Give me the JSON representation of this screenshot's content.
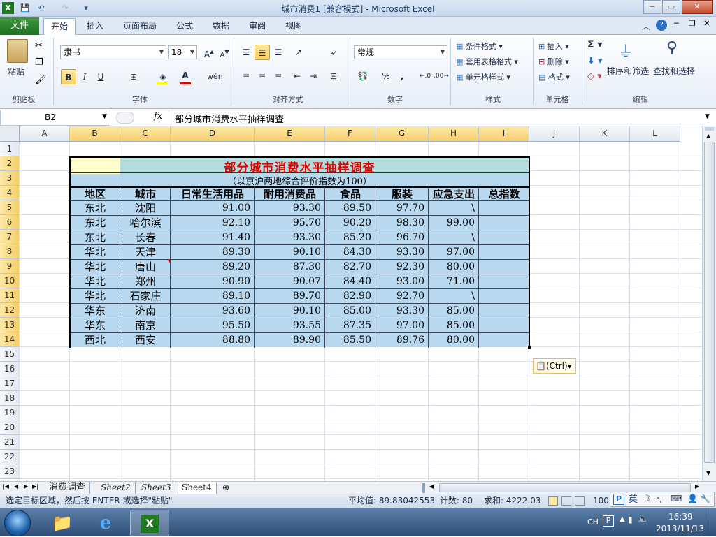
{
  "window": {
    "title": "城市消费1  [兼容模式]  -  Microsoft Excel",
    "min": "─",
    "max": "▭",
    "close": "✕"
  },
  "tabs": {
    "file": "文件",
    "items": [
      "开始",
      "插入",
      "页面布局",
      "公式",
      "数据",
      "审阅",
      "视图"
    ]
  },
  "ribbon": {
    "clipboard": {
      "label": "剪贴板",
      "paste": "粘贴"
    },
    "font": {
      "label": "字体",
      "name": "隶书",
      "size": "18",
      "bold": "B",
      "italic": "I",
      "underline": "U"
    },
    "align": {
      "label": "对齐方式"
    },
    "number": {
      "label": "数字",
      "format": "常规",
      "percent": "%",
      "comma": ","
    },
    "styles": {
      "label": "样式",
      "cond": "条件格式",
      "table": "套用表格格式",
      "cell": "单元格样式"
    },
    "cells": {
      "label": "单元格",
      "insert": "插入",
      "delete": "删除",
      "format": "格式"
    },
    "edit": {
      "label": "编辑",
      "sort": "排序和筛选",
      "find": "查找和选择",
      "sum": "Σ"
    }
  },
  "formula_bar": {
    "namebox": "B2",
    "fx": "fx",
    "content": "部分城市消费水平抽样调查"
  },
  "columns": [
    "A",
    "B",
    "C",
    "D",
    "E",
    "F",
    "G",
    "H",
    "I",
    "J",
    "K",
    "L"
  ],
  "rows": [
    "1",
    "2",
    "3",
    "4",
    "5",
    "6",
    "7",
    "8",
    "9",
    "10",
    "11",
    "12",
    "13",
    "14",
    "15",
    "16",
    "17",
    "18",
    "19",
    "20",
    "21",
    "22",
    "23"
  ],
  "sheet": {
    "title": "部分城市消费水平抽样调查",
    "subtitle": "（以京沪两地综合评价指数为100）",
    "headers": [
      "地区",
      "城市",
      "日常生活用品",
      "耐用消费品",
      "食品",
      "服装",
      "应急支出",
      "总指数"
    ],
    "data": [
      [
        "东北",
        "沈阳",
        "91.00",
        "93.30",
        "89.50",
        "97.70",
        "\\",
        ""
      ],
      [
        "东北",
        "哈尔滨",
        "92.10",
        "95.70",
        "90.20",
        "98.30",
        "99.00",
        ""
      ],
      [
        "东北",
        "长春",
        "91.40",
        "93.30",
        "85.20",
        "96.70",
        "\\",
        ""
      ],
      [
        "华北",
        "天津",
        "89.30",
        "90.10",
        "84.30",
        "93.30",
        "97.00",
        ""
      ],
      [
        "华北",
        "唐山",
        "89.20",
        "87.30",
        "82.70",
        "92.30",
        "80.00",
        ""
      ],
      [
        "华北",
        "郑州",
        "90.90",
        "90.07",
        "84.40",
        "93.00",
        "71.00",
        ""
      ],
      [
        "华北",
        "石家庄",
        "89.10",
        "89.70",
        "82.90",
        "92.70",
        "\\",
        ""
      ],
      [
        "华东",
        "济南",
        "93.60",
        "90.10",
        "85.00",
        "93.30",
        "85.00",
        ""
      ],
      [
        "华东",
        "南京",
        "95.50",
        "93.55",
        "87.35",
        "97.00",
        "85.00",
        ""
      ],
      [
        "西北",
        "西安",
        "88.80",
        "89.90",
        "85.50",
        "89.76",
        "80.00",
        ""
      ]
    ],
    "paste_options": "(Ctrl)"
  },
  "sheet_tabs": [
    "消费调查",
    "Sheet2",
    "Sheet3",
    "Sheet4"
  ],
  "status": {
    "message": "选定目标区域，然后按 ENTER 或选择\"粘贴\"",
    "average": "平均值: 89.83042553",
    "count": "计数: 80",
    "sum": "求和: 4222.03",
    "zoom": "100"
  },
  "ime": {
    "lang": "英"
  },
  "taskbar": {
    "lang": "CH",
    "time": "16:39",
    "date": "2013/11/13"
  },
  "colors": {
    "title_red": "#e00000",
    "table_blue": "#b8d8f0",
    "header_teal": "#b4dcdc",
    "cell_yellow": "#ffffcc",
    "file_green": "#2a8a2a"
  }
}
